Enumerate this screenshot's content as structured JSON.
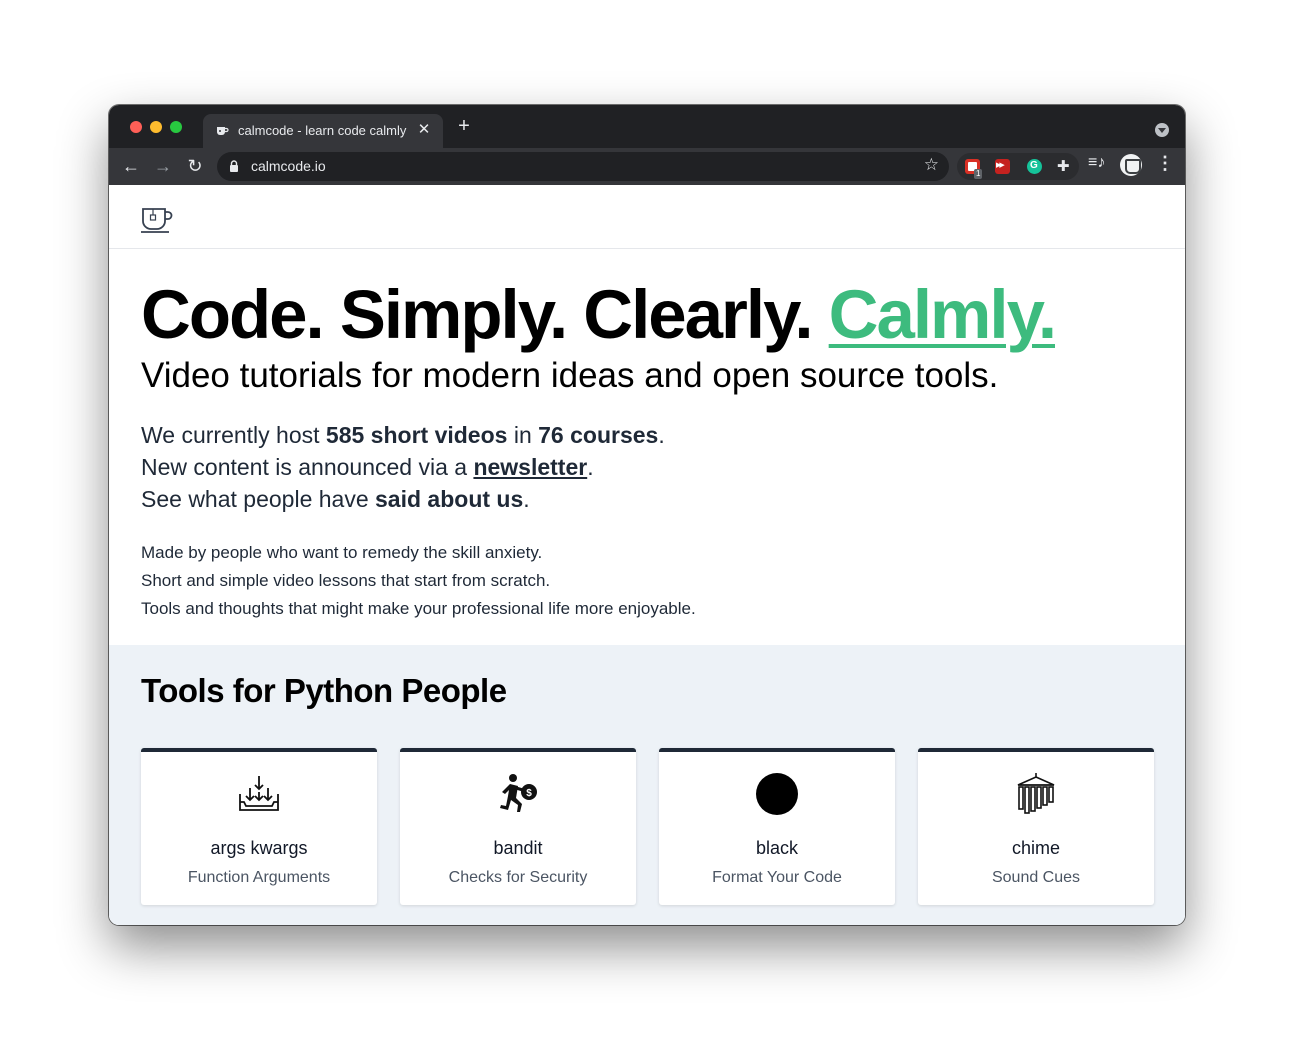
{
  "browser": {
    "tab_title": "calmcode - learn code calmly",
    "tab_close": "✕",
    "new_tab": "+",
    "url": "calmcode.io",
    "nav": {
      "back": "←",
      "forward": "→",
      "reload": "↻"
    },
    "star": "☆",
    "extension_badge": "1",
    "puzzle": "✚",
    "media": "≡♪",
    "menu": "⋮",
    "icons": [
      "favicon-icon",
      "lock-icon",
      "star-icon",
      "extension-icon",
      "puzzle-icon",
      "media-icon",
      "profile-icon",
      "menu-icon"
    ]
  },
  "hero": {
    "title_main": "Code. Simply. Clearly. ",
    "title_accent": "Calmly.",
    "subtitle": "Video tutorials for modern ideas and open source tools."
  },
  "stats": {
    "line1_pre": "We currently host ",
    "videos": "585 short videos",
    "line1_mid": " in ",
    "courses": "76 courses",
    "line1_end": ".",
    "line2_pre": "New content is announced via a ",
    "newsletter": "newsletter",
    "line2_end": ".",
    "line3_pre": "See what people have ",
    "said_about": "said about us",
    "line3_end": "."
  },
  "about": {
    "line1": "Made by people who want to remedy the skill anxiety.",
    "line2": "Short and simple video lessons that start from scratch.",
    "line3": "Tools and thoughts that might make your professional life more enjoyable."
  },
  "tools": {
    "heading": "Tools for Python People",
    "cards": [
      {
        "title": "args kwargs",
        "subtitle": "Function Arguments",
        "icon": "inbox-arrows-icon"
      },
      {
        "title": "bandit",
        "subtitle": "Checks for Security",
        "icon": "bandit-runner-icon"
      },
      {
        "title": "black",
        "subtitle": "Format Your Code",
        "icon": "black-circle-icon"
      },
      {
        "title": "chime",
        "subtitle": "Sound Cues",
        "icon": "wind-chime-icon"
      }
    ]
  },
  "colors": {
    "accent": "#3dbb7e",
    "tools_background": "#edf2f7",
    "card_border": "#1f2937"
  }
}
